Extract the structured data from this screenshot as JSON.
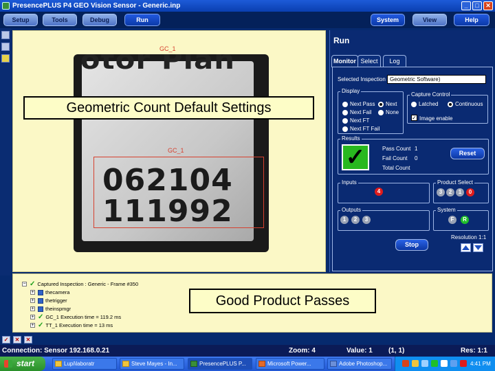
{
  "window": {
    "title": "PresencePLUS P4 GEO Vision Sensor - Generic.inp",
    "minimize": "_",
    "maximize": "□",
    "close": "✕"
  },
  "toolbar": {
    "buttons": [
      {
        "label": "Setup"
      },
      {
        "label": "Tools"
      },
      {
        "label": "Debug"
      },
      {
        "label": "Run"
      }
    ],
    "system_label": "System",
    "view_label": "View",
    "help_label": "Help"
  },
  "image_pane": {
    "gc_top_label": "GC_1",
    "gc_roi_label": "GC_1",
    "part_text": "otor Plan",
    "digits_line1": "062104",
    "digits_line2": "111992"
  },
  "callouts": {
    "top": "Geometric Count Default Settings",
    "bottom": "Good Product Passes"
  },
  "run_panel": {
    "title": "Run",
    "tabs": [
      "Monitor",
      "Select",
      "Log"
    ],
    "selected_inspection_label": "Selected Inspection",
    "selected_inspection_value": "Geometric Software)",
    "display": {
      "label": "Display",
      "options": [
        "Next Pass",
        "Next Fail",
        "Next FT",
        "Next FT Fail",
        "Next",
        "None"
      ]
    },
    "capture_control": {
      "label": "Capture Control",
      "options": [
        "Latched",
        "Continuous"
      ],
      "image_enable_label": "Image enable"
    },
    "results": {
      "label": "Results",
      "pass_count_label": "Pass Count",
      "pass_count": "1",
      "fail_count_label": "Fail Count",
      "fail_count": "0",
      "total_count_label": "Total Count",
      "reset_label": "Reset"
    },
    "inputs_label": "Inputs",
    "inputs_value": "4",
    "product_select": {
      "label": "Product Select",
      "values": [
        "3",
        "2",
        "1",
        "0"
      ]
    },
    "outputs": {
      "label": "Outputs",
      "values": [
        "1",
        "2",
        "3"
      ]
    },
    "system": {
      "label": "System",
      "values": [
        "F",
        "R"
      ]
    },
    "stop_label": "Stop",
    "resolution_label": "Resolution 1:1"
  },
  "tree": {
    "rows": [
      {
        "text": "Captured Inspection : Generic - Frame #350",
        "icon": "check"
      },
      {
        "text": "thecamera",
        "icon": "camera"
      },
      {
        "text": "thetrigger",
        "icon": "camera"
      },
      {
        "text": "theinspmgr",
        "icon": "camera"
      },
      {
        "text": "GC_1 Execution time = 119.2 ms",
        "icon": "check"
      },
      {
        "text": "TT_1 Execution time = 13 ms",
        "icon": "check"
      }
    ]
  },
  "status_bar": {
    "connection": "Connection: Sensor 192.168.0.21",
    "zoom": "Zoom: 4",
    "value": "Value: 1",
    "coords": "(1, 1)",
    "res": "Res: 1:1"
  },
  "taskbar": {
    "start_label": "start",
    "tasks": [
      "Lupi\\laboratr",
      "Steve Mayes - In...",
      "PresencePLUS P...",
      "Microsoft Power...",
      "Adobe Photoshop..."
    ],
    "clock": "4:41 PM"
  },
  "colors": {
    "panel_bg": "#0a2a72",
    "image_bg": "#fbf8c6",
    "pass_green": "#28b81f",
    "roi_red": "#d6402e"
  }
}
